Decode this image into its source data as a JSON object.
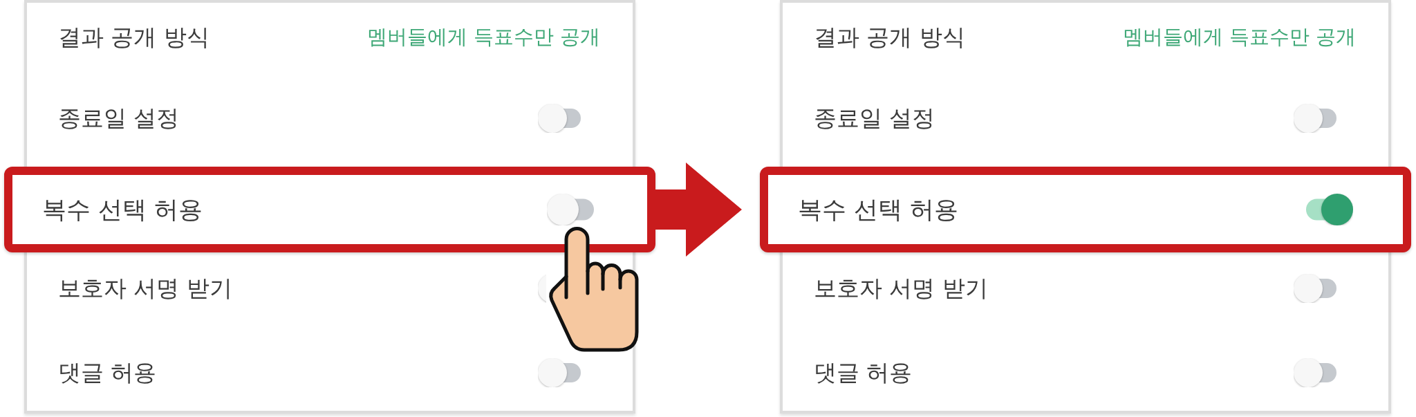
{
  "panels": [
    {
      "rows": [
        {
          "kind": "value",
          "label": "결과 공개 방식",
          "value": "멤버들에게 득표수만 공개",
          "highlighted": false
        },
        {
          "kind": "toggle",
          "label": "종료일 설정",
          "on": false,
          "highlighted": false
        },
        {
          "kind": "toggle",
          "label": "복수 선택 허용",
          "on": false,
          "highlighted": true
        },
        {
          "kind": "toggle",
          "label": "보호자 서명 받기",
          "on": false,
          "highlighted": false
        },
        {
          "kind": "toggle",
          "label": "댓글 허용",
          "on": false,
          "highlighted": false
        }
      ]
    },
    {
      "rows": [
        {
          "kind": "value",
          "label": "결과 공개 방식",
          "value": "멤버들에게 득표수만 공개",
          "highlighted": false
        },
        {
          "kind": "toggle",
          "label": "종료일 설정",
          "on": false,
          "highlighted": false
        },
        {
          "kind": "toggle",
          "label": "복수 선택 허용",
          "on": true,
          "highlighted": true
        },
        {
          "kind": "toggle",
          "label": "보호자 서명 받기",
          "on": false,
          "highlighted": false
        },
        {
          "kind": "toggle",
          "label": "댓글 허용",
          "on": false,
          "highlighted": false
        }
      ]
    }
  ]
}
